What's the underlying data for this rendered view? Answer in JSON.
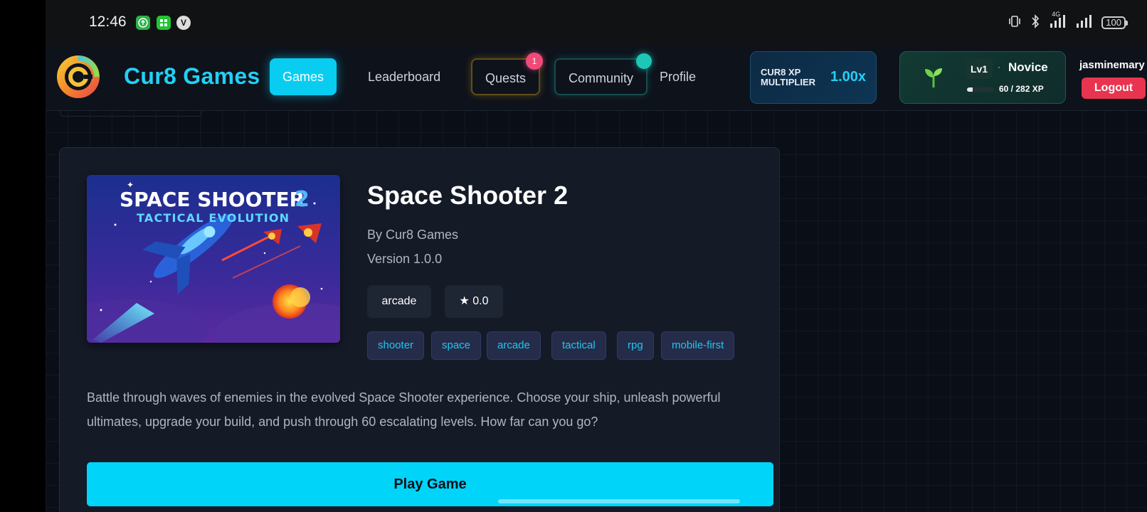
{
  "status_bar": {
    "time": "12:46",
    "app_icons": [
      "upload-app-icon",
      "grid-app-icon",
      "v-app-icon"
    ],
    "network": "4G",
    "battery": "100"
  },
  "header": {
    "brand": "Cur8 Games",
    "nav": [
      {
        "label": "Games",
        "active": true
      },
      {
        "label": "Leaderboard"
      },
      {
        "label": "Quests",
        "badge": "1"
      },
      {
        "label": "Community"
      },
      {
        "label": "Profile"
      }
    ],
    "xp_multiplier": {
      "label": "CUR8 XP MULTIPLIER",
      "value": "1.00x"
    },
    "level": {
      "lv": "Lv1",
      "separator": "·",
      "title": "Novice",
      "xp_text": "60 / 282 XP",
      "xp_fraction": 0.213
    },
    "username": "jasminemary",
    "logout_label": "Logout"
  },
  "game": {
    "cover": {
      "title_line": "SPACE SHOOTER",
      "title_num": "2",
      "subtitle": "TACTICAL EVOLUTION"
    },
    "title": "Space Shooter 2",
    "by": "By Cur8 Games",
    "version": "Version 1.0.0",
    "genre": "arcade",
    "rating": "★ 0.0",
    "tags": [
      "shooter",
      "space",
      "arcade",
      "tactical",
      "rpg",
      "mobile-first"
    ],
    "description": "Battle through waves of enemies in the evolved Space Shooter experience. Choose your ship, unleash powerful ultimates, upgrade your build, and push through 60 escalating levels. How far can you go?",
    "play_label": "Play Game"
  },
  "colors": {
    "accent": "#00d4f9",
    "brand": "#22d0f5",
    "logout": "#e8344e",
    "background": "#0a0e17"
  }
}
